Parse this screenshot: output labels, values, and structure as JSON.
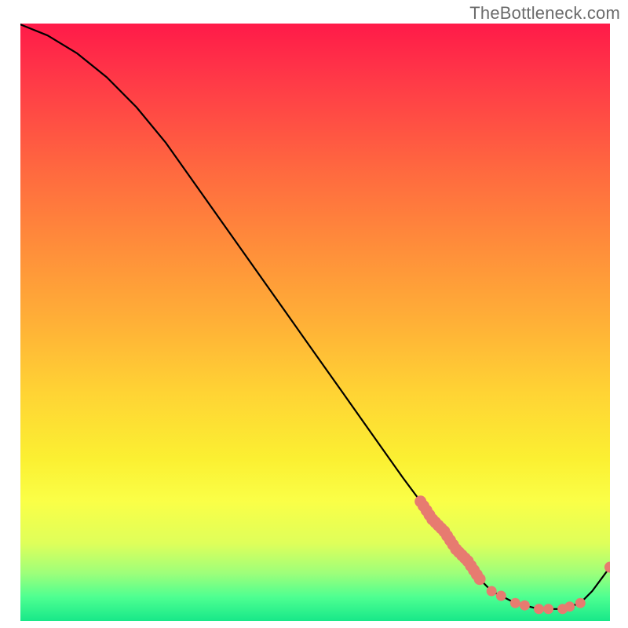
{
  "watermark": "TheBottleneck.com",
  "chart_data": {
    "type": "line",
    "title": "",
    "xlabel": "",
    "ylabel": "",
    "xlim": [
      0,
      100
    ],
    "ylim": [
      0,
      100
    ],
    "grid": false,
    "series": [
      {
        "name": "curve",
        "x": [
          0,
          5,
          10,
          15,
          20,
          25,
          30,
          35,
          40,
          45,
          50,
          55,
          60,
          65,
          68,
          70,
          72,
          74,
          76,
          78,
          80,
          84,
          88,
          92,
          95,
          97,
          100
        ],
        "y": [
          100,
          98,
          95,
          91,
          86,
          80,
          73,
          66,
          59,
          52,
          45,
          38,
          31,
          24,
          20,
          17,
          15,
          12,
          10,
          7,
          5,
          3,
          2,
          2,
          3,
          5,
          9
        ]
      }
    ],
    "markers": [
      {
        "name": "highlight-segment-upper",
        "on_series": "curve",
        "x": [
          68,
          70,
          72,
          74,
          76,
          78
        ],
        "note": "overlapping salmon dots along steep descent"
      },
      {
        "name": "highlight-segment-valley",
        "on_series": "curve",
        "x": [
          80,
          84,
          88,
          92,
          95
        ],
        "note": "dots across valley floor"
      },
      {
        "name": "highlight-end-dot",
        "on_series": "curve",
        "x": [
          100
        ],
        "note": "single dot at right edge on upturn"
      }
    ],
    "colors": {
      "curve_stroke": "#000000",
      "marker_fill": "#e77b70",
      "gradient_top": "#ff1a49",
      "gradient_bottom": "#18e889"
    }
  }
}
